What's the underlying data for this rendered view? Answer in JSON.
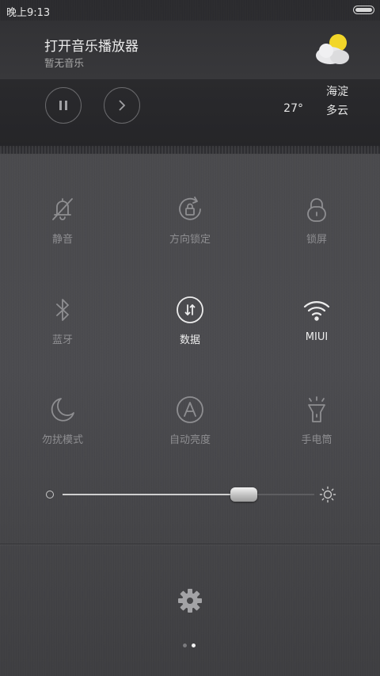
{
  "status_bar": {
    "time": "晚上9:13",
    "battery_level": 1.0
  },
  "music": {
    "title": "打开音乐播放器",
    "subtitle": "暂无音乐",
    "pause_icon": "pause-icon",
    "next_icon": "chevron-right-icon"
  },
  "weather": {
    "city": "海淀",
    "temperature": "27°",
    "condition": "多云",
    "icon": "partly-cloudy-icon"
  },
  "toggles": [
    {
      "label": "静音",
      "icon": "bell-off-icon",
      "active": false
    },
    {
      "label": "方向锁定",
      "icon": "rotation-lock-icon",
      "active": false
    },
    {
      "label": "锁屏",
      "icon": "lock-icon",
      "active": false
    },
    {
      "label": "蓝牙",
      "icon": "bluetooth-icon",
      "active": false
    },
    {
      "label": "数据",
      "icon": "mobile-data-icon",
      "active": true
    },
    {
      "label": "MIUI",
      "icon": "wifi-icon",
      "active": true
    },
    {
      "label": "勿扰模式",
      "icon": "moon-icon",
      "active": false
    },
    {
      "label": "自动亮度",
      "icon": "auto-brightness-icon",
      "active": false
    },
    {
      "label": "手电筒",
      "icon": "flashlight-icon",
      "active": false
    }
  ],
  "brightness": {
    "level": 0.72,
    "min_icon": "brightness-low-icon",
    "max_icon": "brightness-high-icon"
  },
  "settings": {
    "icon": "gear-icon"
  },
  "pager": {
    "pages": 2,
    "current": 2
  },
  "colors": {
    "icon_inactive": "#8e8e91",
    "icon_active": "#ececec",
    "weather_sun": "#f2d629"
  }
}
